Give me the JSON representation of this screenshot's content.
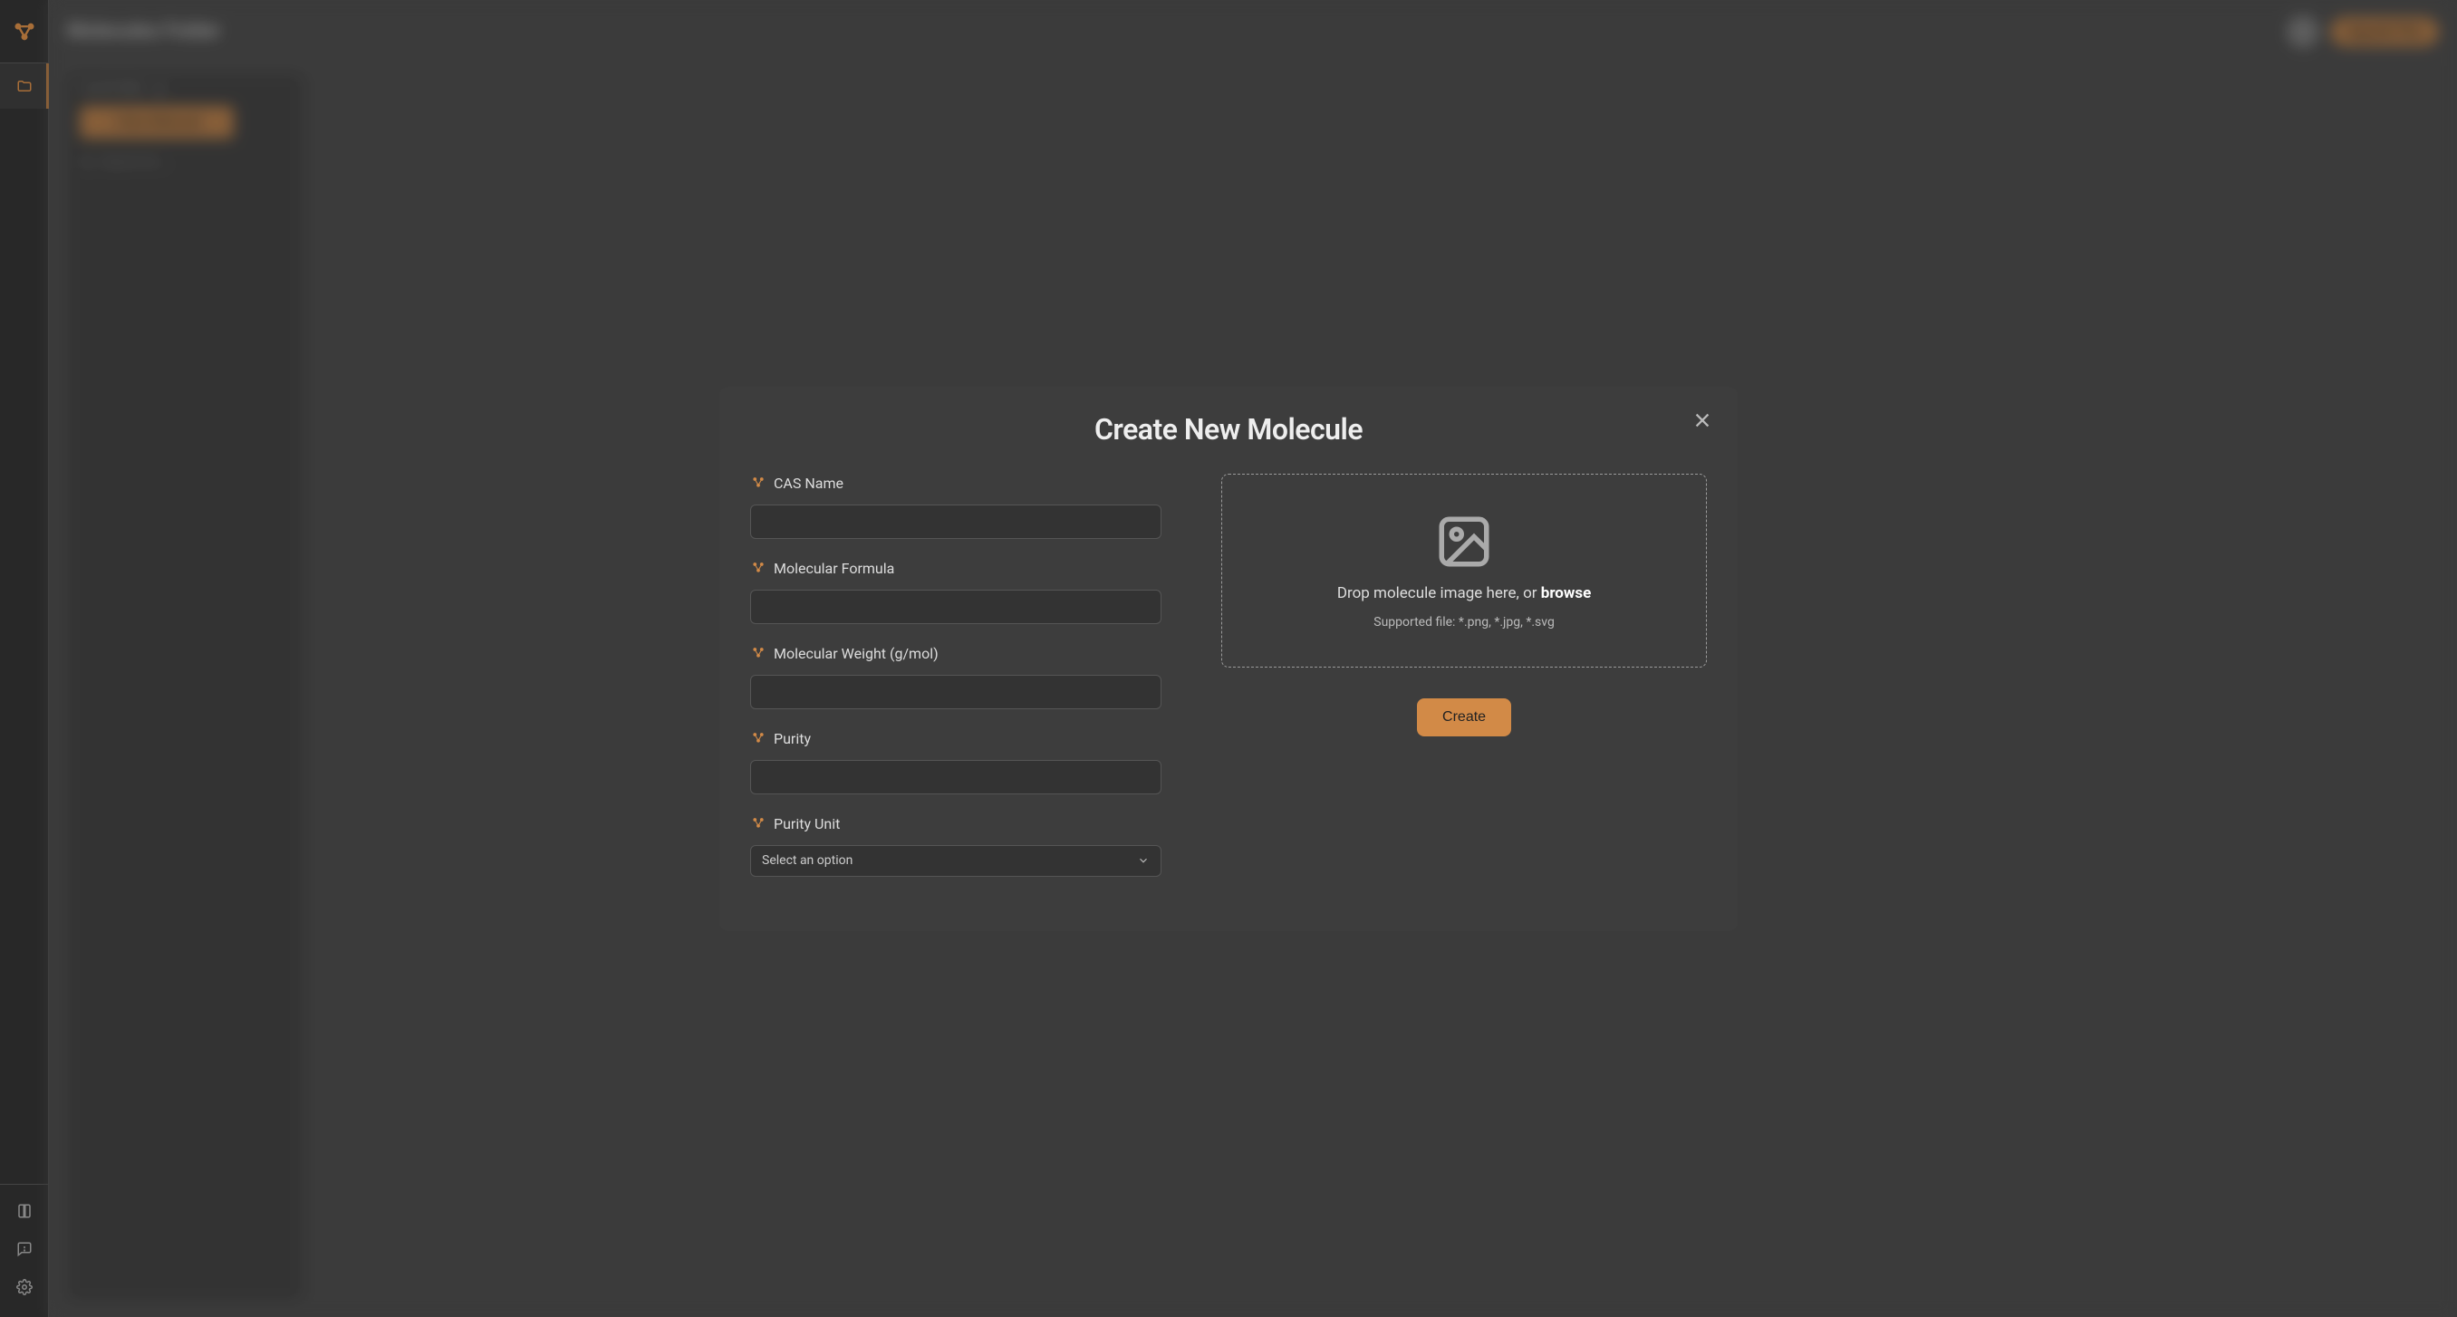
{
  "background": {
    "page_title": "Molecules Folder",
    "upgrade_label": "Upgrade Plan",
    "tabs": {
      "local": "Local Folder",
      "cloud": "☁"
    },
    "new_molecule_button": "+ New Molecule",
    "search_label": "Search for …"
  },
  "modal": {
    "title": "Create New Molecule",
    "close_label": "Close",
    "fields": {
      "cas_name": {
        "label": "CAS Name",
        "value": ""
      },
      "molecular_formula": {
        "label": "Molecular Formula",
        "value": ""
      },
      "molecular_weight": {
        "label": "Molecular Weight (g/mol)",
        "value": ""
      },
      "purity": {
        "label": "Purity",
        "value": ""
      },
      "purity_unit": {
        "label": "Purity Unit",
        "placeholder": "Select an option"
      }
    },
    "dropzone": {
      "text_prefix": "Drop molecule image here, or ",
      "text_link": "browse",
      "subtext": "Supported file: *.png, *.jpg, *.svg"
    },
    "create_button": "Create"
  }
}
